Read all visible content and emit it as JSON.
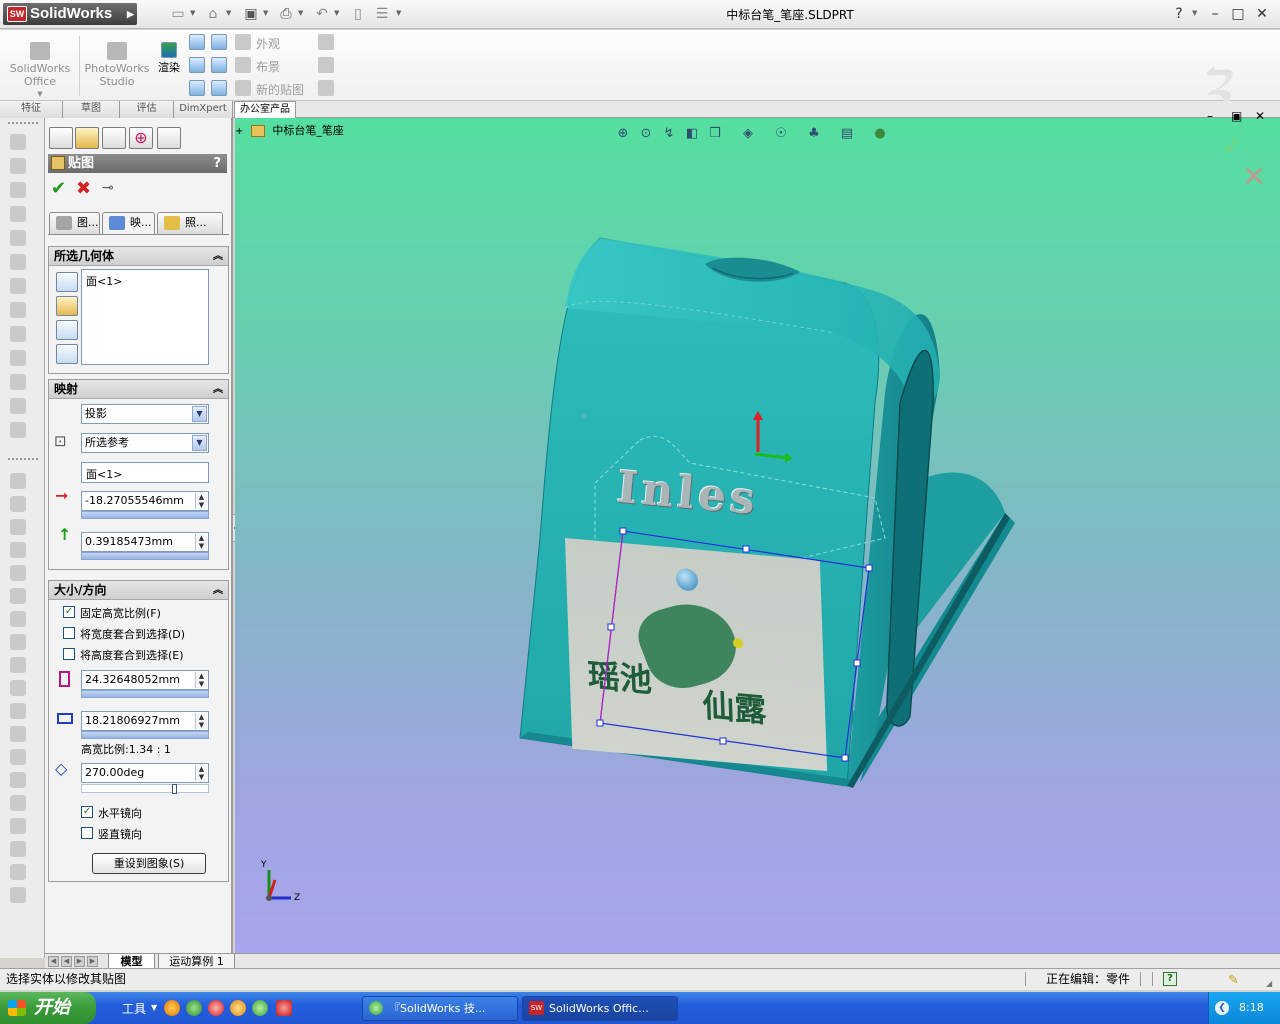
{
  "app": {
    "brand": "SolidWorks",
    "doc_title": "中标台笔_笔座.SLDPRT",
    "help_symbol": "?"
  },
  "ribbon": {
    "office_label_1": "SolidWorks",
    "office_label_2": "Office",
    "photoworks_label_1": "PhotoWorks",
    "photoworks_label_2": "Studio",
    "render_label": "渲染",
    "appearance_label": "外观",
    "scene_label": "布景",
    "new_decal_label": "新的贴图"
  },
  "command_tabs": [
    "特征",
    "草图",
    "评估",
    "DimXpert",
    "办公室产品"
  ],
  "pm": {
    "title": "贴图",
    "help": "?",
    "tabs": [
      "图...",
      "映...",
      "照..."
    ],
    "selected_geometry": {
      "header": "所选几何体",
      "face": "面<1>"
    },
    "mapping": {
      "header": "映射",
      "type": "投影",
      "reference": "所选参考",
      "face": "面<1>",
      "horizontal": "-18.27055546mm",
      "vertical": "0.39185473mm"
    },
    "size": {
      "header": "大小/方向",
      "fixed_ratio": "固定高宽比例(F)",
      "fit_width": "将宽度套合到选择(D)",
      "fit_height": "将高度套合到选择(E)",
      "width": "24.32648052mm",
      "height": "18.21806927mm",
      "ratio": "高宽比例:1.34 : 1",
      "angle": "270.00deg",
      "mirror_h": "水平镜向",
      "mirror_v": "竖直镜向",
      "reset": "重设到图象(S)"
    }
  },
  "viewport": {
    "tree_label": "中标台笔_笔座",
    "model_text": "Inles",
    "decal_text_1": "瑶池",
    "decal_text_2": "仙露",
    "triad_y": "Y",
    "triad_z": "Z"
  },
  "bottom_tabs": [
    "模型",
    "运动算例 1"
  ],
  "status": {
    "left": "选择实体以修改其贴图",
    "mode": "正在编辑：零件"
  },
  "taskbar": {
    "start": "开始",
    "tools": "工具",
    "tasks": [
      "『SolidWorks 技...",
      "SolidWorks Offic..."
    ],
    "clock": "8:18"
  },
  "colors": {
    "model_teal": "#25b8b8",
    "viewport_top": "#55dfa0",
    "viewport_bottom": "#a7a6ee",
    "sw_red": "#c8242b"
  }
}
